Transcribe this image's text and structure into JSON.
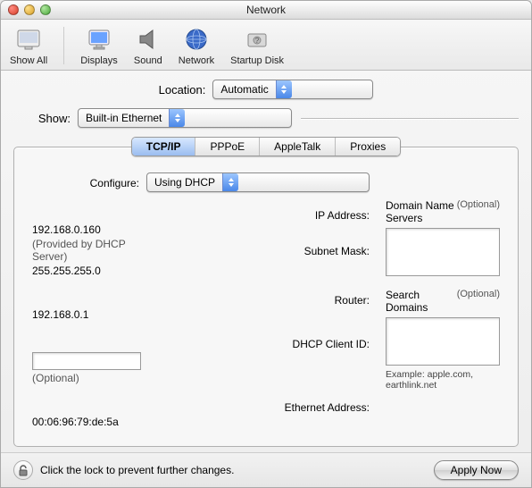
{
  "window": {
    "title": "Network"
  },
  "toolbar": {
    "show_all": "Show All",
    "displays": "Displays",
    "sound": "Sound",
    "network": "Network",
    "startup_disk": "Startup Disk"
  },
  "location": {
    "label": "Location:",
    "value": "Automatic"
  },
  "show": {
    "label": "Show:",
    "value": "Built-in Ethernet"
  },
  "tabs": {
    "tcpip": "TCP/IP",
    "pppoe": "PPPoE",
    "appletalk": "AppleTalk",
    "proxies": "Proxies",
    "active": "tcpip"
  },
  "configure": {
    "label": "Configure:",
    "value": "Using DHCP"
  },
  "ip_address": {
    "label": "IP Address:",
    "value": "192.168.0.160",
    "note": "(Provided by DHCP Server)"
  },
  "subnet_mask": {
    "label": "Subnet Mask:",
    "value": "255.255.255.0"
  },
  "router": {
    "label": "Router:",
    "value": "192.168.0.1"
  },
  "dhcp_client_id": {
    "label": "DHCP Client ID:",
    "value": "",
    "note": "(Optional)"
  },
  "ethernet_address": {
    "label": "Ethernet Address:",
    "value": "00:06:96:79:de:5a"
  },
  "dns": {
    "label": "Domain Name Servers",
    "optional": "(Optional)",
    "value": ""
  },
  "search_domains": {
    "label": "Search Domains",
    "optional": "(Optional)",
    "value": "",
    "example": "Example: apple.com, earthlink.net"
  },
  "footer": {
    "lock_text": "Click the lock to prevent further changes.",
    "apply": "Apply Now"
  }
}
